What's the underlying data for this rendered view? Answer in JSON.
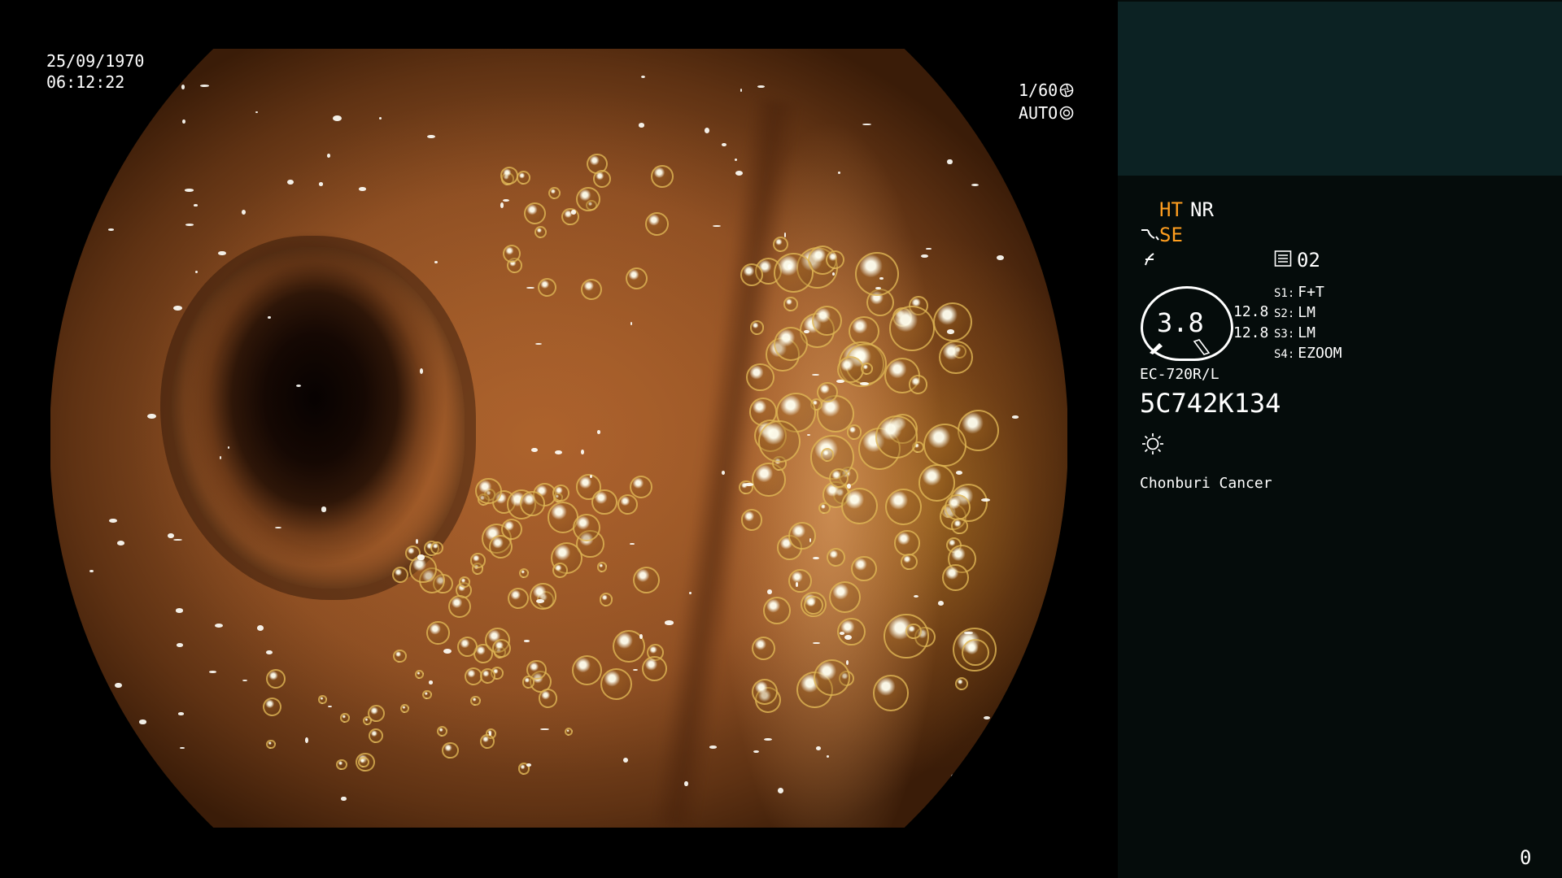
{
  "overlay": {
    "date": "25/09/1970",
    "time": "06:12:22",
    "shutter": "1/60",
    "iris": "AUTO"
  },
  "panel": {
    "ht": "HT",
    "nr": "NR",
    "se": "SE",
    "record_num": "02",
    "gauge_value": "3.8",
    "value_top": "12.8",
    "value_bottom": "12.8",
    "switches": [
      {
        "label": "S1:",
        "value": "F+T"
      },
      {
        "label": "S2:",
        "value": "LM"
      },
      {
        "label": "S3:",
        "value": "LM"
      },
      {
        "label": "S4:",
        "value": "EZOOM"
      }
    ],
    "scope_model": "EC-720R/L",
    "serial": "5C742K134",
    "institution": "Chonburi Cancer",
    "counter": "0"
  },
  "colors": {
    "accent": "#ff9e1f",
    "panel_bg": "#050c0b",
    "panel_header": "#0c2223"
  },
  "icons": [
    "shutter-icon",
    "iris-icon",
    "scope-bend-icon",
    "no-freeze-icon",
    "record-icon",
    "light-icon"
  ]
}
